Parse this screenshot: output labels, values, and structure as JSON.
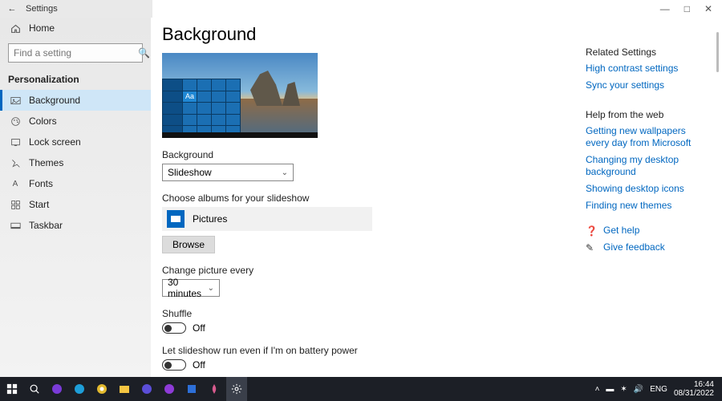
{
  "titlebar": {
    "app": "Settings"
  },
  "sidebar": {
    "home": "Home",
    "search_placeholder": "Find a setting",
    "heading": "Personalization",
    "items": [
      {
        "label": "Background"
      },
      {
        "label": "Colors"
      },
      {
        "label": "Lock screen"
      },
      {
        "label": "Themes"
      },
      {
        "label": "Fonts"
      },
      {
        "label": "Start"
      },
      {
        "label": "Taskbar"
      }
    ]
  },
  "main": {
    "title": "Background",
    "preview_sample": "Aa",
    "bg_label": "Background",
    "bg_value": "Slideshow",
    "albums_label": "Choose albums for your slideshow",
    "album_value": "Pictures",
    "browse": "Browse",
    "interval_label": "Change picture every",
    "interval_value": "30 minutes",
    "shuffle_label": "Shuffle",
    "shuffle_state": "Off",
    "battery_label": "Let slideshow run even if I'm on battery power",
    "battery_state": "Off"
  },
  "right": {
    "related_heading": "Related Settings",
    "links_related": [
      "High contrast settings",
      "Sync your settings"
    ],
    "help_heading": "Help from the web",
    "links_help": [
      "Getting new wallpapers every day from Microsoft",
      "Changing my desktop background",
      "Showing desktop icons",
      "Finding new themes"
    ],
    "get_help": "Get help",
    "give_feedback": "Give feedback"
  },
  "taskbar": {
    "lang": "ENG",
    "time": "16:44",
    "date": "08/31/2022"
  }
}
